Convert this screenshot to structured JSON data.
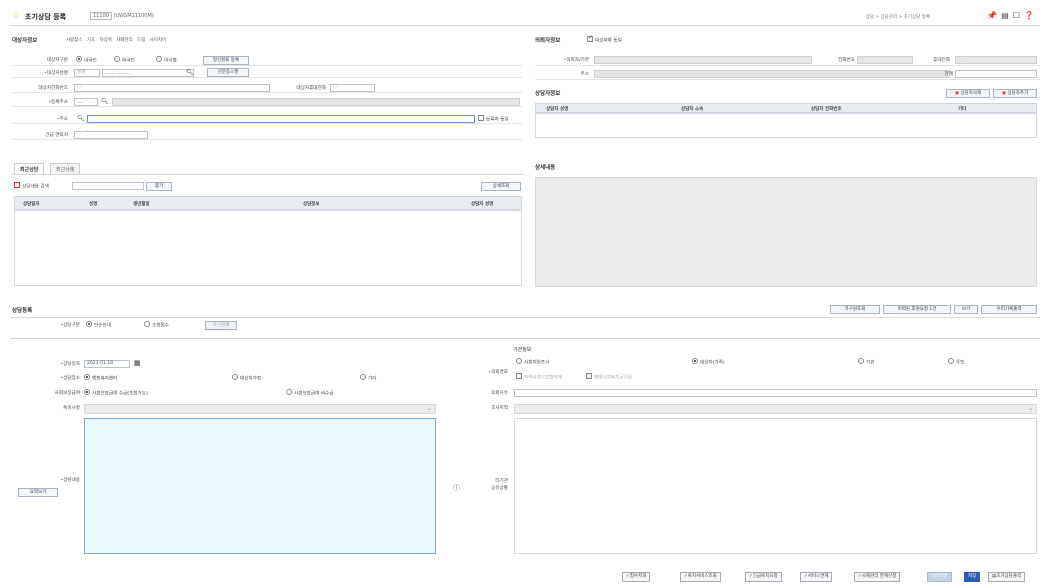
{
  "header": {
    "title": "초기상담 등록",
    "code_badge": "11100",
    "code_text": "(UWSM11100M)",
    "breadcrumb": "상담 > 상담관리 > 초기상담 등록",
    "icons": [
      "star-icon",
      "pin-icon",
      "print-icon",
      "window-icon",
      "help-icon"
    ]
  },
  "target_section": {
    "title": "대상자정보",
    "links": [
      "사람찾스",
      "기초",
      "차상위",
      "사례관리",
      "드림",
      "사이지어"
    ],
    "rows": {
      "type_label": "대상자구분",
      "type_options": [
        "내국인",
        "외국인",
        "미식별"
      ],
      "type_selected": 0,
      "reg_button": "정신원표 등록",
      "name_label": "대상자성명",
      "name_placeholder": "성명",
      "id_button": "신분증스캔",
      "phone_label": "대상자전화번호",
      "phone_value": "-      -",
      "mobile_label": "대상자휴대전화",
      "mobile_value": "-      -",
      "reg_addr_label": "등록주소",
      "addr_label": "주소",
      "same_addr_label": "등록과 동일",
      "emergency_label": "긴급 연락처",
      "emergency_value": "-      -"
    }
  },
  "requester_section": {
    "title": "의뢰자정보",
    "same_label": "대상자와 동일",
    "requester_label": "의뢰자/기관",
    "phone_label": "전화번호",
    "phone_value": "-      -",
    "mobile_label": "휴대전화",
    "mobile_value": "-      -",
    "addr_label": "주소",
    "relation_label": "관계"
  },
  "counselor_section": {
    "title": "상담자정보",
    "delete_button": "상담자삭제",
    "add_button": "상담자추가",
    "columns": [
      "상담자 성명",
      "상담자 소속",
      "상담자 전화번호",
      "기타"
    ]
  },
  "history_tabs": [
    "최근상담",
    "최근사례"
  ],
  "history": {
    "search_label": "상담내용 검색",
    "search_button": "찾기",
    "detail_button": "상세조회",
    "columns": [
      "상담일자",
      "성명",
      "생년월일",
      "상담정보",
      "상담자 성명"
    ]
  },
  "detail_section": {
    "title": "상세내용"
  },
  "consult_reg": {
    "title": "상담등록",
    "buttons": [
      "가구원조회",
      "이력된 후원요청 1건",
      "보기",
      "우리기록출력"
    ],
    "type_label": "상담구분",
    "type_options": [
      "단순안내",
      "초청접수"
    ],
    "type_selected": 0,
    "family_button": "가구원세",
    "date_label": "상담일자",
    "date_value": "2023-01-18",
    "place_label": "상담장소",
    "place_options": [
      "행정복지센터",
      "대상자가정",
      "기타"
    ],
    "place_selected": 0,
    "consent_label": "사회보장급여",
    "consent_options": [
      "사회보장급여 수급(조회가능)",
      "사회보장급여 비수급"
    ],
    "consent_selected": 0,
    "special_label": "특이사항",
    "content_label": "상담내용",
    "content_button": "요약보기"
  },
  "org_section": {
    "title": "기관정보",
    "route_label": "의뢰경로",
    "route_options": [
      "사회지원조사",
      "대상자(가족)",
      "기관",
      "주민"
    ],
    "route_selected": 1,
    "route_checks": [
      "지역사회보장협의체",
      "명예사회복지공무원"
    ],
    "reason_label": "의뢰사유",
    "investigator_label": "조사지역",
    "other_org_label": "타기관\n공유상황"
  },
  "bottom_buttons": [
    "험수저희",
    "복지서비스조회",
    "긴급복지요청",
    "서비스연계",
    "사례관리 연계신청",
    "미리저장",
    "저장",
    "초기상담출력"
  ]
}
